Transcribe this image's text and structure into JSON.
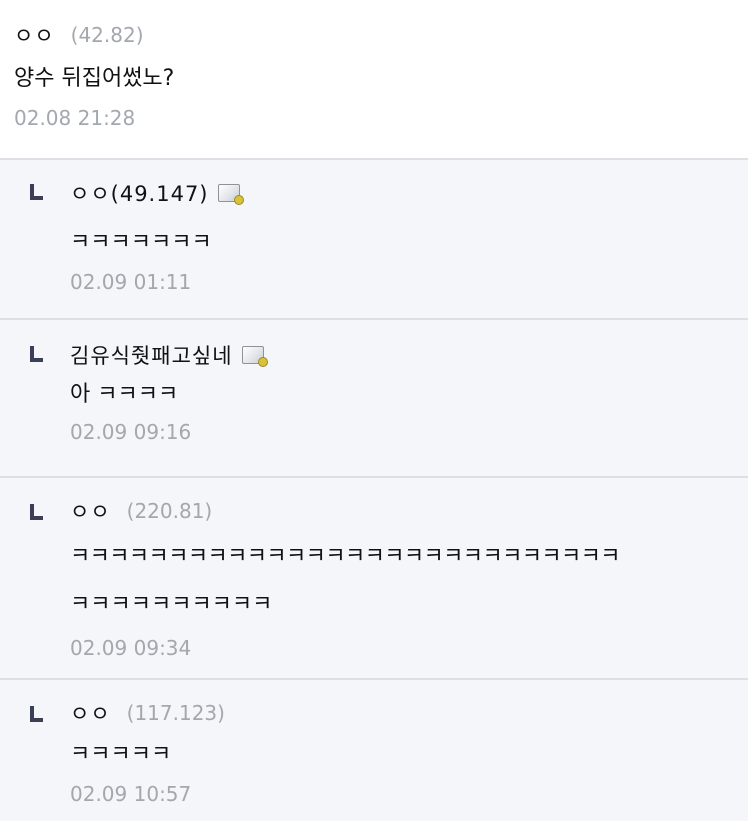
{
  "root": {
    "nickname": "ㅇㅇ",
    "ip": "(42.82)",
    "text": "양수 뒤집어썼노?",
    "date": "02.08 21:28"
  },
  "replies": [
    {
      "nickname": "ㅇㅇ(49.147)",
      "ip": "",
      "has_memo_icon": true,
      "lines": [
        "ㅋㅋㅋㅋㅋㅋㅋ"
      ],
      "date": "02.09 01:11"
    },
    {
      "nickname": "김유식줫패고싶네",
      "ip": "",
      "has_memo_icon": true,
      "lines": [
        "아 ㅋㅋㅋㅋ"
      ],
      "date": "02.09 09:16"
    },
    {
      "nickname": "ㅇㅇ",
      "ip": "(220.81)",
      "has_memo_icon": false,
      "lines": [
        "ㅋㅋㅋㅋㅋㅋㅋㅋㅋㅋㅋㅋㅋㅋㅋㅋㅋㅋㅋㅋㅋㅋㅋㅋㅋㅋㅋㅋ",
        "ㅋㅋㅋㅋㅋㅋㅋㅋㅋㅋ"
      ],
      "date": "02.09 09:34"
    },
    {
      "nickname": "ㅇㅇ",
      "ip": "(117.123)",
      "has_memo_icon": false,
      "lines": [
        "ㅋㅋㅋㅋㅋ"
      ],
      "date": "02.09 10:57"
    }
  ],
  "icons": {
    "reply": "reply-corner-icon",
    "memo": "memo-icon"
  },
  "colors": {
    "reply_bg": "#f4f6f9",
    "meta_text": "#a3a7ae",
    "divider": "#dcdfe4"
  }
}
